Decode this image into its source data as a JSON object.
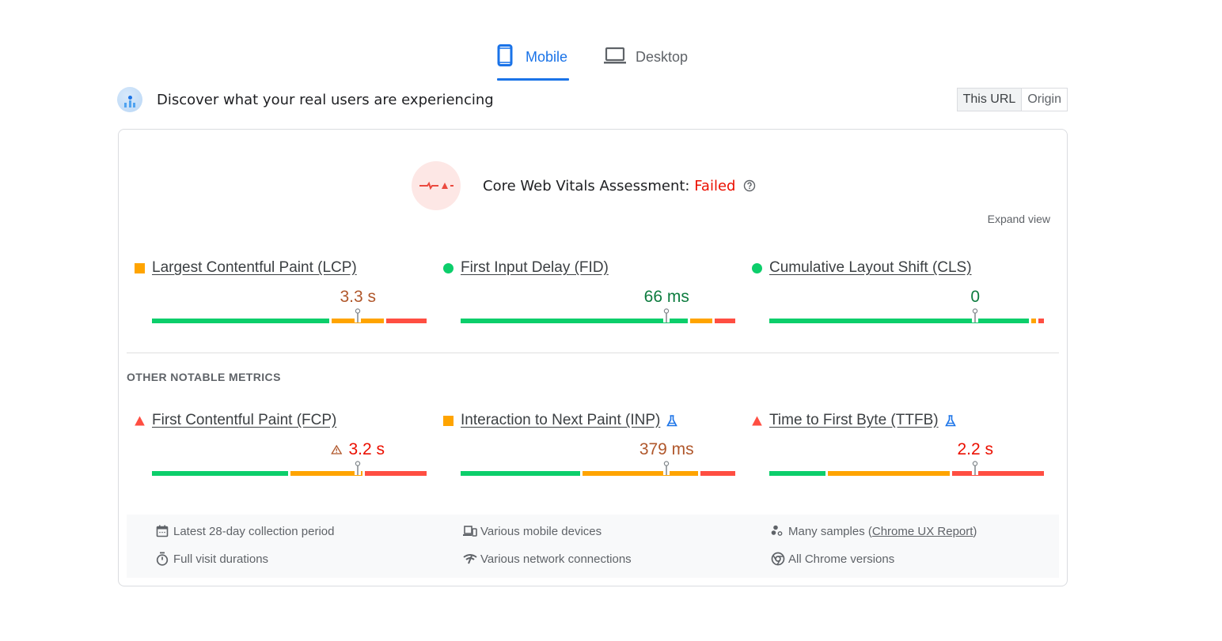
{
  "tabs": [
    {
      "label": "Mobile",
      "icon": "smartphone-icon",
      "active": true
    },
    {
      "label": "Desktop",
      "icon": "laptop-icon",
      "active": false
    }
  ],
  "header": {
    "title": "Discover what your real users are experiencing",
    "scope_options": [
      {
        "label": "This URL",
        "active": true
      },
      {
        "label": "Origin",
        "active": false
      }
    ]
  },
  "assessment": {
    "label": "Core Web Vitals Assessment: ",
    "status": "Failed",
    "expand_label": "Expand view"
  },
  "colors": {
    "good": "#0cce6b",
    "needs_improvement": "#ffa400",
    "poor": "#ff4e42",
    "value_good": "#0d7c3f",
    "value_ni": "#b0572b",
    "value_poor": "#eb0f00",
    "accent": "#1a73e8"
  },
  "core_metrics": [
    {
      "name": "Largest Contentful Paint (LCP)",
      "value": "3.3 s",
      "rating": "needs_improvement",
      "status_icon": "square-icon",
      "experimental": false,
      "warning": false,
      "distribution": {
        "good": 0.65,
        "needs_improvement": 0.2,
        "poor": 0.15
      },
      "p75_position": 0.75
    },
    {
      "name": "First Input Delay (FID)",
      "value": "66 ms",
      "rating": "good",
      "status_icon": "circle-icon",
      "experimental": false,
      "warning": false,
      "distribution": {
        "good": 0.83,
        "needs_improvement": 0.09,
        "poor": 0.08
      },
      "p75_position": 0.75
    },
    {
      "name": "Cumulative Layout Shift (CLS)",
      "value": "0",
      "rating": "good",
      "status_icon": "circle-icon",
      "experimental": false,
      "warning": false,
      "distribution": {
        "good": 0.95,
        "needs_improvement": 0.025,
        "poor": 0.025
      },
      "p75_position": 0.75
    }
  ],
  "other_label": "OTHER NOTABLE METRICS",
  "other_metrics": [
    {
      "name": "First Contentful Paint (FCP)",
      "value": "3.2 s",
      "rating": "poor",
      "status_icon": "triangle-icon",
      "experimental": false,
      "warning": true,
      "distribution": {
        "good": 0.5,
        "needs_improvement": 0.27,
        "poor": 0.23
      },
      "p75_position": 0.75
    },
    {
      "name": "Interaction to Next Paint (INP)",
      "value": "379 ms",
      "rating": "needs_improvement",
      "status_icon": "square-icon",
      "experimental": true,
      "warning": false,
      "distribution": {
        "good": 0.44,
        "needs_improvement": 0.43,
        "poor": 0.13
      },
      "p75_position": 0.75
    },
    {
      "name": "Time to First Byte (TTFB)",
      "value": "2.2 s",
      "rating": "poor",
      "status_icon": "triangle-icon",
      "experimental": true,
      "warning": false,
      "distribution": {
        "good": 0.21,
        "needs_improvement": 0.45,
        "poor": 0.34
      },
      "p75_position": 0.75
    }
  ],
  "footer": {
    "items": [
      {
        "text": "Latest 28-day collection period",
        "icon": "calendar-icon"
      },
      {
        "text": "Various mobile devices",
        "icon": "devices-icon"
      },
      {
        "text": "Many samples (",
        "link": "Chrome UX Report",
        "suffix": ")",
        "icon": "samples-icon"
      },
      {
        "text": "Full visit durations",
        "icon": "timer-icon"
      },
      {
        "text": "Various network connections",
        "icon": "network-icon"
      },
      {
        "text": "All Chrome versions",
        "icon": "chrome-icon"
      }
    ]
  }
}
